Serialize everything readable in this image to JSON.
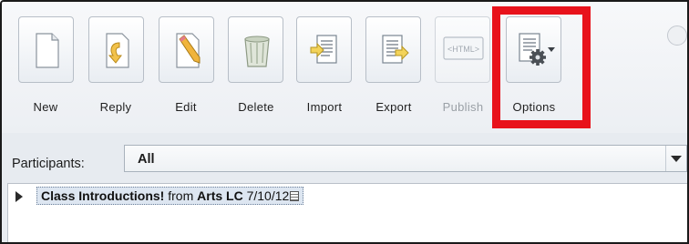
{
  "toolbar": {
    "buttons": [
      {
        "label": "New",
        "icon": "new-document-icon",
        "enabled": true
      },
      {
        "label": "Reply",
        "icon": "reply-icon",
        "enabled": true
      },
      {
        "label": "Edit",
        "icon": "edit-pencil-icon",
        "enabled": true
      },
      {
        "label": "Delete",
        "icon": "trash-icon",
        "enabled": true
      },
      {
        "label": "Import",
        "icon": "import-icon",
        "enabled": true
      },
      {
        "label": "Export",
        "icon": "export-icon",
        "enabled": true
      },
      {
        "label": "Publish",
        "icon": "html-icon",
        "enabled": false,
        "icon_text": "<HTML>"
      },
      {
        "label": "Options",
        "icon": "options-gear-icon",
        "enabled": true
      }
    ],
    "highlight_color": "#e8121b"
  },
  "filter": {
    "label": "Participants:",
    "selected": "All"
  },
  "thread": {
    "title": "Class Introductions!",
    "from_label": " from ",
    "author": "Arts LC",
    "date": " 7/10/12"
  }
}
